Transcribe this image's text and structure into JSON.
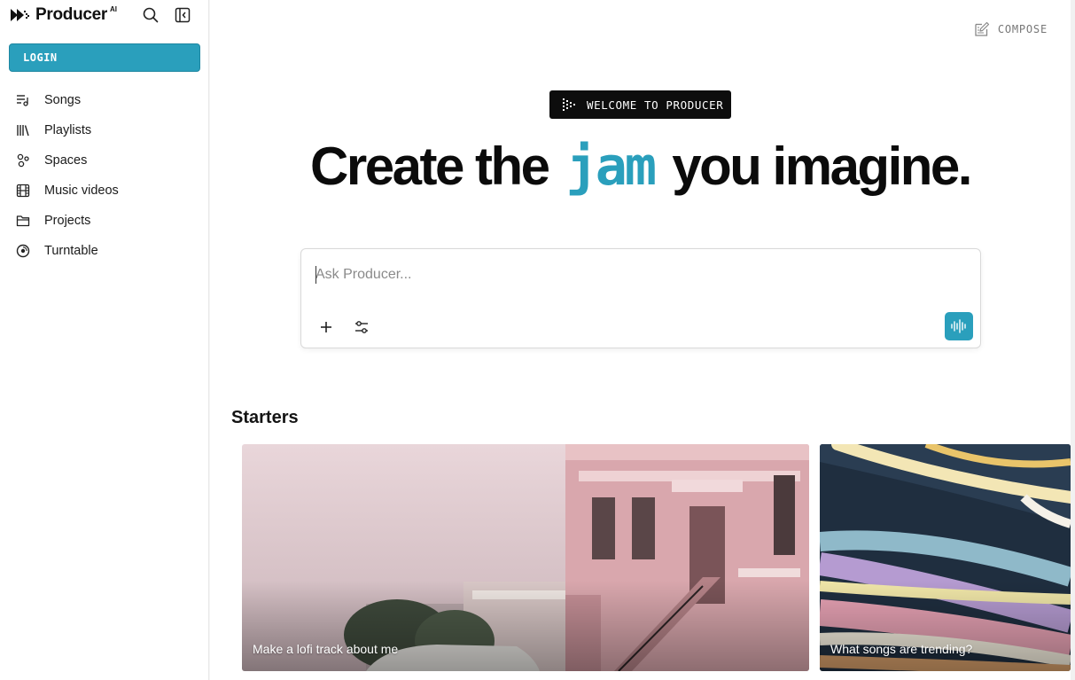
{
  "brand": {
    "name": "Producer",
    "superscript": "AI"
  },
  "sidebar": {
    "login_label": "LOGIN",
    "items": [
      {
        "label": "Songs",
        "icon": "songs-icon"
      },
      {
        "label": "Playlists",
        "icon": "playlists-icon"
      },
      {
        "label": "Spaces",
        "icon": "spaces-icon"
      },
      {
        "label": "Music videos",
        "icon": "film-icon"
      },
      {
        "label": "Projects",
        "icon": "folder-icon"
      },
      {
        "label": "Turntable",
        "icon": "turntable-icon"
      }
    ]
  },
  "header": {
    "compose_label": "COMPOSE"
  },
  "hero": {
    "welcome_label": "WELCOME TO PRODUCER",
    "headline_before": "Create the",
    "headline_accent": "jam",
    "headline_after": "you imagine."
  },
  "prompt": {
    "placeholder": "Ask Producer...",
    "value": ""
  },
  "starters": {
    "title": "Starters",
    "cards": [
      {
        "caption": "Make a lofi track about me"
      },
      {
        "caption": "What songs are trending?"
      }
    ]
  },
  "colors": {
    "accent": "#2a9fbc",
    "dark": "#0d0d0d"
  }
}
